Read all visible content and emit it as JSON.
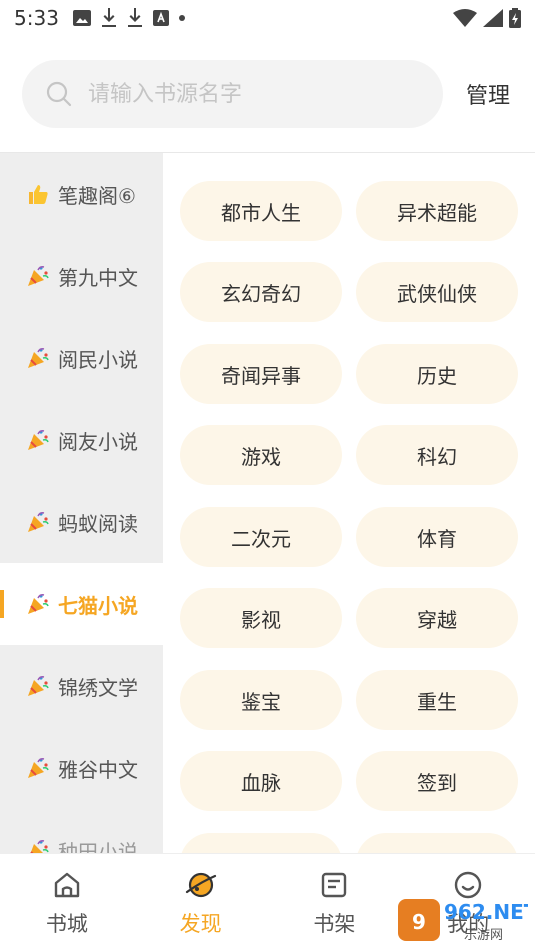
{
  "status_bar": {
    "time": "5:33"
  },
  "search": {
    "placeholder": "请输入书源名字",
    "manage_label": "管理"
  },
  "sidebar": {
    "items": [
      {
        "label": "笔趣阁⑥",
        "icon": "thumbs-up-emoji"
      },
      {
        "label": "第九中文",
        "icon": "party-popper-emoji"
      },
      {
        "label": "阅民小说",
        "icon": "party-popper-emoji"
      },
      {
        "label": "阅友小说",
        "icon": "party-popper-emoji"
      },
      {
        "label": "蚂蚁阅读",
        "icon": "party-popper-emoji"
      },
      {
        "label": "七猫小说",
        "icon": "party-popper-emoji",
        "active": true
      },
      {
        "label": "锦绣文学",
        "icon": "party-popper-emoji"
      },
      {
        "label": "雅谷中文",
        "icon": "party-popper-emoji"
      },
      {
        "label": "种田小说",
        "icon": "party-popper-emoji"
      }
    ]
  },
  "tags": [
    "都市人生",
    "异术超能",
    "玄幻奇幻",
    "武侠仙侠",
    "奇闻异事",
    "历史",
    "游戏",
    "科幻",
    "二次元",
    "体育",
    "影视",
    "穿越",
    "鉴宝",
    "重生",
    "血脉",
    "签到"
  ],
  "bottom_nav": {
    "items": [
      {
        "label": "书城",
        "icon": "home-icon"
      },
      {
        "label": "发现",
        "icon": "planet-icon",
        "active": true
      },
      {
        "label": "书架",
        "icon": "bookshelf-icon"
      },
      {
        "label": "我的",
        "icon": "smiley-icon"
      }
    ]
  },
  "colors": {
    "accent": "#f5a623",
    "tag_bg": "#fdf6e8",
    "sidebar_bg": "#eeeeee"
  },
  "watermark": {
    "text": "962.NET",
    "subtext": "乐游网"
  }
}
